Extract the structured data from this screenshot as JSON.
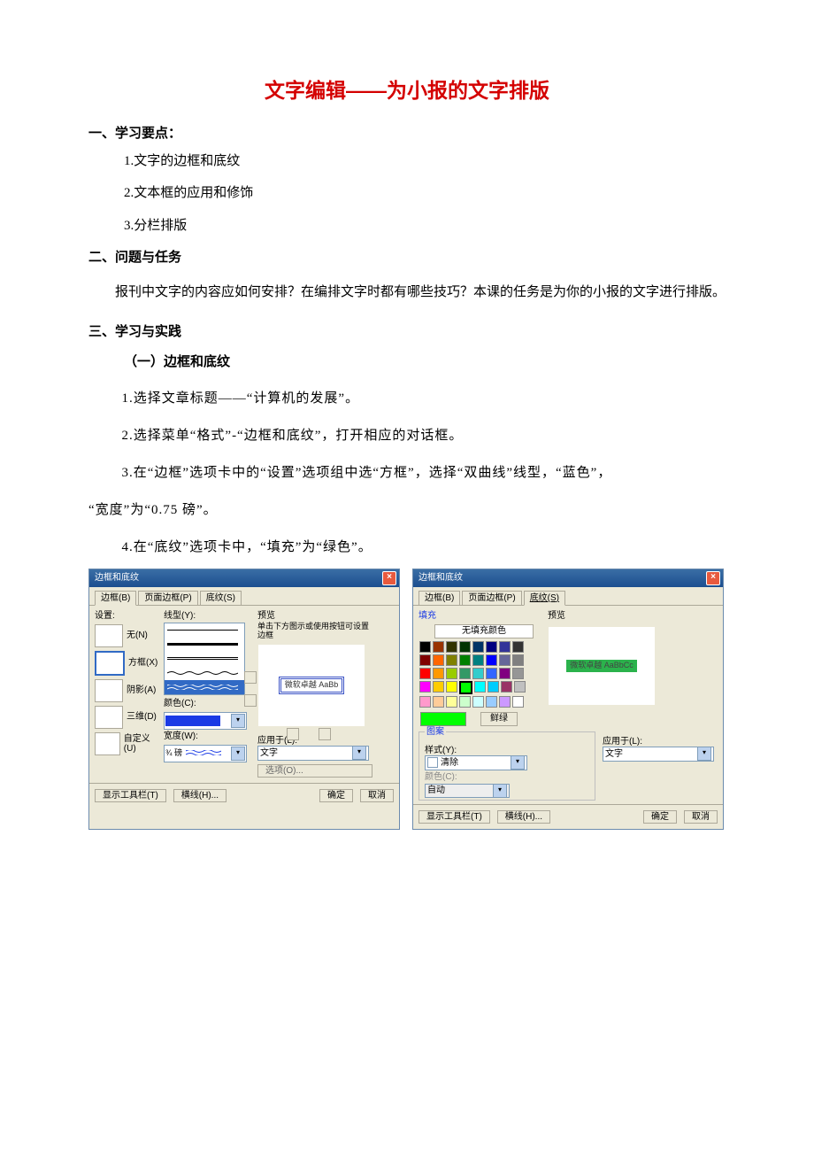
{
  "title": "文字编辑——为小报的文字排版",
  "s1": {
    "head": "一、学习要点：",
    "i1": "1.文字的边框和底纹",
    "i2": "2.文本框的应用和修饰",
    "i3": "3.分栏排版"
  },
  "s2": {
    "head": "二、问题与任务",
    "body": "报刊中文字的内容应如何安排？在编排文字时都有哪些技巧？本课的任务是为你的小报的文字进行排版。"
  },
  "s3": {
    "head": "三、学习与实践",
    "sub": "（一）边框和底纹",
    "p1": "1.选择文章标题——“计算机的发展”。",
    "p2": "2.选择菜单“格式”-“边框和底纹”，打开相应的对话框。",
    "p3a": "3.在“边框”选项卡中的“设置”选项组中选“方框”，选择“双曲线”线型，“蓝色”，",
    "p3b": "“宽度”为“0.75 磅”。",
    "p4": "4.在“底纹”选项卡中，“填充”为“绿色”。"
  },
  "dlg": {
    "title": "边框和底纹",
    "tab_border": "边框(B)",
    "tab_page": "页面边框(P)",
    "tab_shading": "底纹(S)",
    "setting": "设置:",
    "none": "无(N)",
    "box": "方框(X)",
    "shadow": "阴影(A)",
    "threeD": "三维(D)",
    "custom": "自定义(U)",
    "style": "线型(Y):",
    "color": "颜色(C):",
    "width": "宽度(W):",
    "width_val": "¾ 磅",
    "preview": "预览",
    "preview_note": "单击下方图示或使用按钮可设置边框",
    "preview_text_b": "微软卓越 AaBb",
    "preview_text_s": "微软卓越 AaBbCc",
    "apply": "应用于(L):",
    "apply_val": "文字",
    "options": "选项(O)...",
    "show_toolbar": "显示工具栏(T)",
    "hline": "横线(H)...",
    "ok": "确定",
    "cancel": "取消",
    "fill": "填充",
    "nofill": "无填充颜色",
    "color_name": "鲜绿",
    "pattern": "图案",
    "style2": "样式(Y):",
    "clear": "清除",
    "color2": "颜色(C):",
    "auto": "自动"
  }
}
